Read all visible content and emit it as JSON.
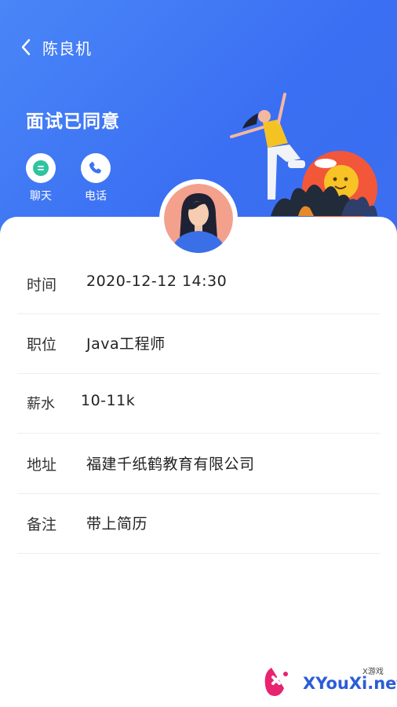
{
  "nav": {
    "title": "陈良机"
  },
  "status": "面试已同意",
  "actions": [
    {
      "label": "聊天",
      "icon": "chat-bubble-icon",
      "color": "#2fc4a0"
    },
    {
      "label": "电话",
      "icon": "phone-icon",
      "color": "#3a74f2"
    }
  ],
  "details": [
    {
      "label": "时间",
      "value": "2020-12-12 14:30"
    },
    {
      "label": "职位",
      "value": "Java工程师"
    },
    {
      "label": "薪水",
      "value": "10-11k"
    },
    {
      "label": "地址",
      "value": "福建千纸鹤教育有限公司"
    },
    {
      "label": "备注",
      "value": "带上简历"
    }
  ],
  "watermark": {
    "text": "XYouXi.net",
    "small": "X游戏"
  },
  "colors": {
    "header": "#3d73f3",
    "accent_chat": "#2fc4a0",
    "accent_phone": "#3a74f2"
  }
}
